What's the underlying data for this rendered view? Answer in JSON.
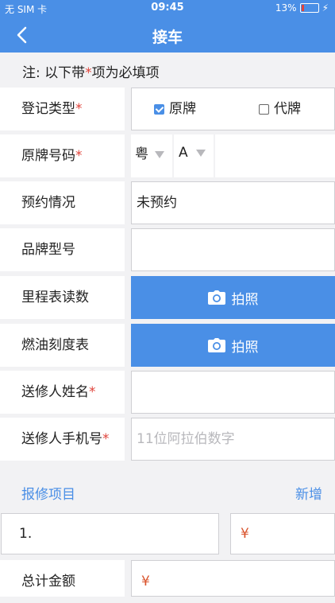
{
  "status": {
    "carrier": "无 SIM 卡",
    "time": "09:45",
    "battery": "13%"
  },
  "nav": {
    "title": "接车"
  },
  "note": {
    "text": "注: 以下带",
    "star": "*",
    "tail": "项为必填项"
  },
  "form": {
    "reg_type": {
      "label": "登记类型",
      "star": "*",
      "opt1": "原牌",
      "opt2": "代牌",
      "selected": "原牌"
    },
    "plate": {
      "label": "原牌号码",
      "star": "*",
      "province": "粤",
      "letter": "A"
    },
    "appointment": {
      "label": "预约情况",
      "value": "未预约"
    },
    "brand": {
      "label": "品牌型号",
      "value": ""
    },
    "odometer": {
      "label": "里程表读数",
      "button": "拍照"
    },
    "fuel": {
      "label": "燃油刻度表",
      "button": "拍照"
    },
    "sender_name": {
      "label": "送修人姓名",
      "star": "*",
      "value": ""
    },
    "sender_phone": {
      "label": "送修人手机号",
      "star": "*",
      "placeholder": "11位阿拉伯数字"
    }
  },
  "repair": {
    "section": "报修项目",
    "add": "新增",
    "item_no": "1.",
    "currency": "¥"
  },
  "total": {
    "label": "总计金额",
    "currency": "¥"
  }
}
